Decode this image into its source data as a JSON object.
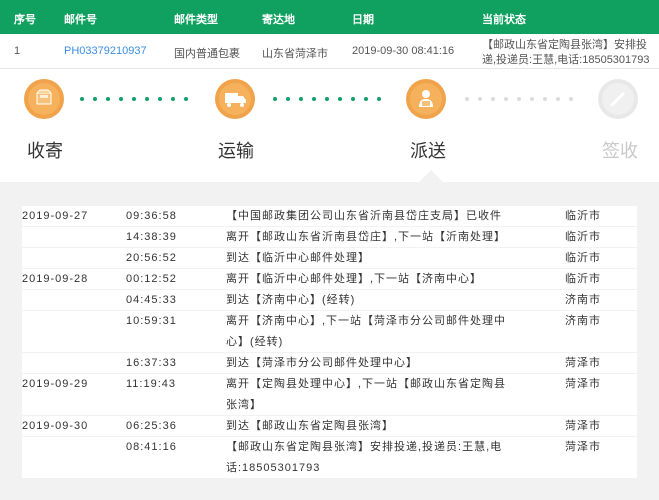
{
  "table": {
    "headers": [
      "序号",
      "邮件号",
      "邮件类型",
      "寄达地",
      "日期",
      "当前状态"
    ],
    "row": {
      "index": "1",
      "tracking_no": "PH03379210937",
      "mail_type": "国内普通包裹",
      "destination": "山东省菏泽市",
      "datetime": "2019-09-30 08:41:16",
      "status": "【邮政山东省定陶县张湾】安排投递,投递员:王慧,电话:18505301793"
    }
  },
  "steps": [
    {
      "label": "收寄",
      "icon": "package-icon",
      "state": "done"
    },
    {
      "label": "运输",
      "icon": "truck-icon",
      "state": "done"
    },
    {
      "label": "派送",
      "icon": "courier-icon",
      "state": "current"
    },
    {
      "label": "签收",
      "icon": "signed-icon",
      "state": "pending"
    }
  ],
  "colors": {
    "header_bg": "#10a060",
    "active_icon": "#f0a34a",
    "link": "#3b8ee0"
  },
  "timeline": [
    {
      "date": "2019-09-27",
      "time": "09:36:58",
      "desc": "【中国邮政集团公司山东省沂南县岱庄支局】已收件",
      "city": "临沂市"
    },
    {
      "date": "",
      "time": "14:38:39",
      "desc": "离开【邮政山东省沂南县岱庄】,下一站【沂南处理】",
      "city": "临沂市"
    },
    {
      "date": "",
      "time": "20:56:52",
      "desc": "到达【临沂中心邮件处理】",
      "city": "临沂市"
    },
    {
      "date": "2019-09-28",
      "time": "00:12:52",
      "desc": "离开【临沂中心邮件处理】,下一站【济南中心】",
      "city": "临沂市"
    },
    {
      "date": "",
      "time": "04:45:33",
      "desc": "到达【济南中心】(经转)",
      "city": "济南市"
    },
    {
      "date": "",
      "time": "10:59:31",
      "desc": "离开【济南中心】,下一站【菏泽市分公司邮件处理中心】(经转)",
      "city": "济南市"
    },
    {
      "date": "",
      "time": "16:37:33",
      "desc": "到达【菏泽市分公司邮件处理中心】",
      "city": "菏泽市"
    },
    {
      "date": "2019-09-29",
      "time": "11:19:43",
      "desc": "离开【定陶县处理中心】,下一站【邮政山东省定陶县张湾】",
      "city": "菏泽市"
    },
    {
      "date": "2019-09-30",
      "time": "06:25:36",
      "desc": "到达【邮政山东省定陶县张湾】",
      "city": "菏泽市"
    },
    {
      "date": "",
      "time": "08:41:16",
      "desc": "【邮政山东省定陶县张湾】安排投递,投递员:王慧,电话:18505301793",
      "city": "菏泽市"
    }
  ]
}
